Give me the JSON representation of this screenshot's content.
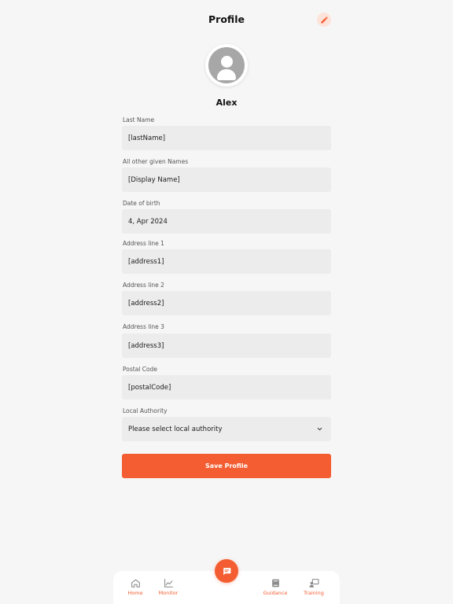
{
  "header": {
    "title": "Profile"
  },
  "profile": {
    "name": "Alex"
  },
  "fields": [
    {
      "label": "Last Name",
      "value": "[lastName]"
    },
    {
      "label": "All other given Names",
      "value": "[Display Name]"
    },
    {
      "label": "Date of birth",
      "value": "4, Apr 2024"
    },
    {
      "label": "Address line 1",
      "value": "[address1]"
    },
    {
      "label": "Address line 2",
      "value": "[address2]"
    },
    {
      "label": "Address line 3",
      "value": "[address3]"
    },
    {
      "label": "Postal Code",
      "value": "[postalCode]"
    }
  ],
  "local_authority": {
    "label": "Local Authority",
    "selected": "Please select local authority"
  },
  "save_label": "Save Profile",
  "nav": {
    "home": "Home",
    "monitor": "Monitor",
    "guidance": "Guidance",
    "training": "Training"
  },
  "colors": {
    "accent": "#f35d31",
    "field_bg": "#ececec",
    "page_bg": "#f6f6f6"
  }
}
